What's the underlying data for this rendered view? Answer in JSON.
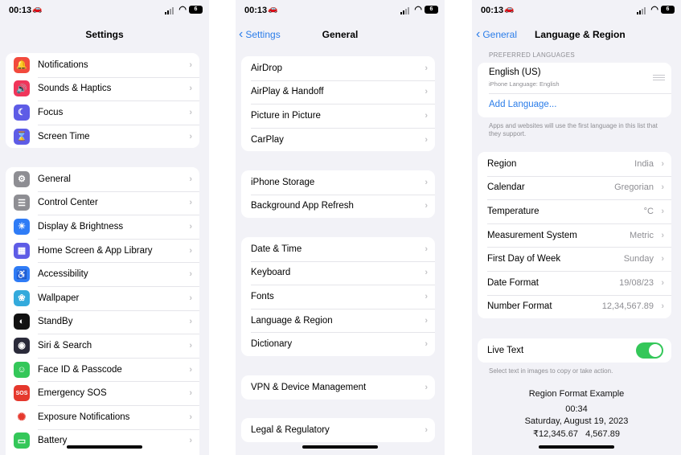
{
  "status_time": "00:13",
  "battery": "6",
  "colors": {
    "accent": "#2b7de9",
    "toggle_on": "#34c759"
  },
  "screen1": {
    "title": "Settings",
    "group1": [
      {
        "label": "Notifications",
        "icon": "bell-icon",
        "glyph": "🔔",
        "color": "#f24a3d"
      },
      {
        "label": "Sounds & Haptics",
        "icon": "speaker-icon",
        "glyph": "🔊",
        "color": "#f0355a"
      },
      {
        "label": "Focus",
        "icon": "moon-icon",
        "glyph": "☾",
        "color": "#5e5ce6"
      },
      {
        "label": "Screen Time",
        "icon": "hourglass-icon",
        "glyph": "⌛",
        "color": "#5e5ce6"
      }
    ],
    "group2": [
      {
        "label": "General",
        "icon": "gear-icon",
        "glyph": "⚙",
        "color": "#8e8e93"
      },
      {
        "label": "Control Center",
        "icon": "switches-icon",
        "glyph": "☰",
        "color": "#8e8e93"
      },
      {
        "label": "Display & Brightness",
        "icon": "sun-icon",
        "glyph": "☀",
        "color": "#2f7cf6"
      },
      {
        "label": "Home Screen & App Library",
        "icon": "grid-icon",
        "glyph": "▦",
        "color": "#5e5ce6"
      },
      {
        "label": "Accessibility",
        "icon": "accessibility-icon",
        "glyph": "♿",
        "color": "#2f7cf6"
      },
      {
        "label": "Wallpaper",
        "icon": "flower-icon",
        "glyph": "❀",
        "color": "#33aadc"
      },
      {
        "label": "StandBy",
        "icon": "standby-icon",
        "glyph": "◐",
        "color": "#111111"
      },
      {
        "label": "Siri & Search",
        "icon": "siri-icon",
        "glyph": "◉",
        "color": "#2b2b3a"
      },
      {
        "label": "Face ID & Passcode",
        "icon": "faceid-icon",
        "glyph": "☺",
        "color": "#34c759"
      },
      {
        "label": "Emergency SOS",
        "icon": "sos-icon",
        "glyph": "SOS",
        "color": "#e5382d"
      },
      {
        "label": "Exposure Notifications",
        "icon": "exposure-icon",
        "glyph": "✺",
        "color": "#ffffff"
      },
      {
        "label": "Battery",
        "icon": "battery-icon",
        "glyph": "▭",
        "color": "#34c759"
      }
    ]
  },
  "screen2": {
    "back": "Settings",
    "title": "General",
    "group1": [
      "AirDrop",
      "AirPlay & Handoff",
      "Picture in Picture",
      "CarPlay"
    ],
    "group2": [
      "iPhone Storage",
      "Background App Refresh"
    ],
    "group3": [
      "Date & Time",
      "Keyboard",
      "Fonts",
      "Language & Region",
      "Dictionary"
    ],
    "group4": [
      "VPN & Device Management"
    ],
    "group5": [
      "Legal & Regulatory"
    ]
  },
  "screen3": {
    "back": "General",
    "title": "Language & Region",
    "preferred_header": "PREFERRED LANGUAGES",
    "language": "English (US)",
    "language_sub": "iPhone Language: English",
    "add_language": "Add Language...",
    "languages_footer": "Apps and websites will use the first language in this list that they support.",
    "region_rows": [
      {
        "label": "Region",
        "value": "India"
      },
      {
        "label": "Calendar",
        "value": "Gregorian"
      },
      {
        "label": "Temperature",
        "value": "°C"
      },
      {
        "label": "Measurement System",
        "value": "Metric"
      },
      {
        "label": "First Day of Week",
        "value": "Sunday"
      },
      {
        "label": "Date Format",
        "value": "19/08/23"
      },
      {
        "label": "Number Format",
        "value": "12,34,567.89"
      }
    ],
    "live_text": "Live Text",
    "live_text_on": true,
    "live_text_footer": "Select text in images to copy or take action.",
    "example_title": "Region Format Example",
    "example_time": "00:34",
    "example_date": "Saturday, August 19, 2023",
    "example_numbers": "₹12,345.67   4,567.89"
  }
}
